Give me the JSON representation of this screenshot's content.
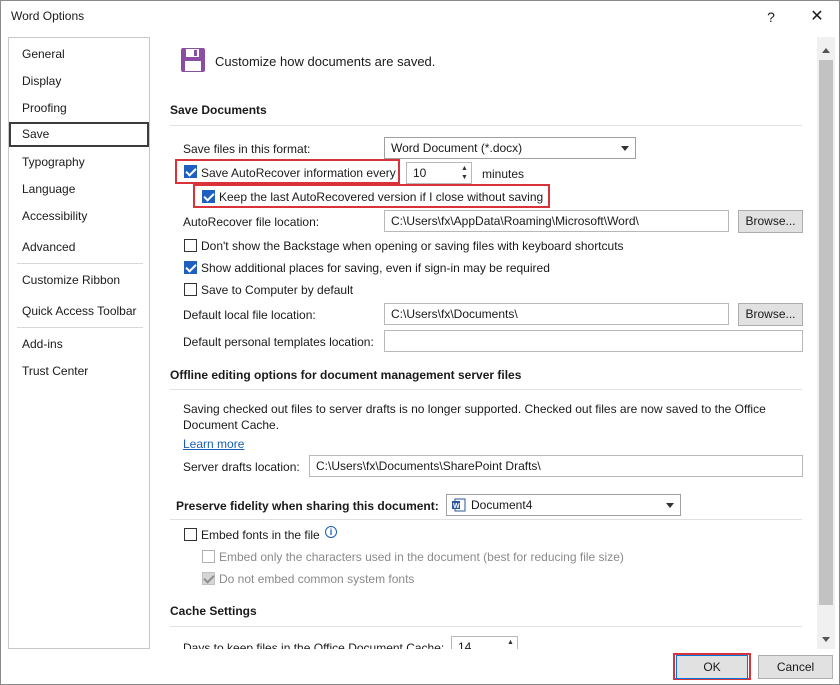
{
  "window": {
    "title": "Word Options",
    "help": "?",
    "close": "✕"
  },
  "sidebar": {
    "items": [
      {
        "label": "General"
      },
      {
        "label": "Display"
      },
      {
        "label": "Proofing"
      },
      {
        "label": "Save"
      },
      {
        "label": "Typography"
      },
      {
        "label": "Language"
      },
      {
        "label": "Accessibility"
      },
      {
        "label": "Advanced"
      },
      {
        "label": "Customize Ribbon"
      },
      {
        "label": "Quick Access Toolbar"
      },
      {
        "label": "Add-ins"
      },
      {
        "label": "Trust Center"
      }
    ],
    "selected": "Save"
  },
  "header": {
    "text": "Customize how documents are saved.",
    "icon": "save-icon"
  },
  "save_documents": {
    "heading": "Save Documents",
    "format_label": "Save files in this format:",
    "format_value": "Word Document (*.docx)",
    "autorecover_label": "Save AutoRecover information every",
    "autorecover_checked": true,
    "autorecover_minutes": "10",
    "minutes_label": "minutes",
    "keep_last_label": "Keep the last AutoRecovered version if I close without saving",
    "keep_last_checked": true,
    "autorecover_location_label": "AutoRecover file location:",
    "autorecover_location_value": "C:\\Users\\fx\\AppData\\Roaming\\Microsoft\\Word\\",
    "browse_label": "Browse...",
    "dont_show_backstage_label": "Don't show the Backstage when opening or saving files with keyboard shortcuts",
    "dont_show_backstage_checked": false,
    "show_additional_label": "Show additional places for saving, even if sign-in may be required",
    "show_additional_checked": true,
    "save_to_computer_label": "Save to Computer by default",
    "save_to_computer_checked": false,
    "default_local_label": "Default local file location:",
    "default_local_value": "C:\\Users\\fx\\Documents\\",
    "default_templates_label": "Default personal templates location:",
    "default_templates_value": ""
  },
  "offline": {
    "heading": "Offline editing options for document management server files",
    "notice_line1": "Saving checked out files to server drafts is no longer supported. Checked out files are now saved to the Office",
    "notice_line2": "Document Cache.",
    "learn_more": "Learn more",
    "server_drafts_label": "Server drafts location:",
    "server_drafts_value": "C:\\Users\\fx\\Documents\\SharePoint Drafts\\"
  },
  "fidelity": {
    "heading": "Preserve fidelity when sharing this document:",
    "document_value": "Document4",
    "embed_fonts_label": "Embed fonts in the file",
    "embed_fonts_checked": false,
    "embed_only_label": "Embed only the characters used in the document (best for reducing file size)",
    "do_not_embed_label": "Do not embed common system fonts",
    "do_not_embed_checked": true
  },
  "cache": {
    "heading": "Cache Settings",
    "days_label": "Days to keep files in the Office Document Cache:",
    "days_value": "14"
  },
  "footer": {
    "ok_label": "OK",
    "cancel_label": "Cancel"
  },
  "colors": {
    "highlight": "#d9323b",
    "accent": "#1f5fbf",
    "link": "#1a5fb4"
  }
}
